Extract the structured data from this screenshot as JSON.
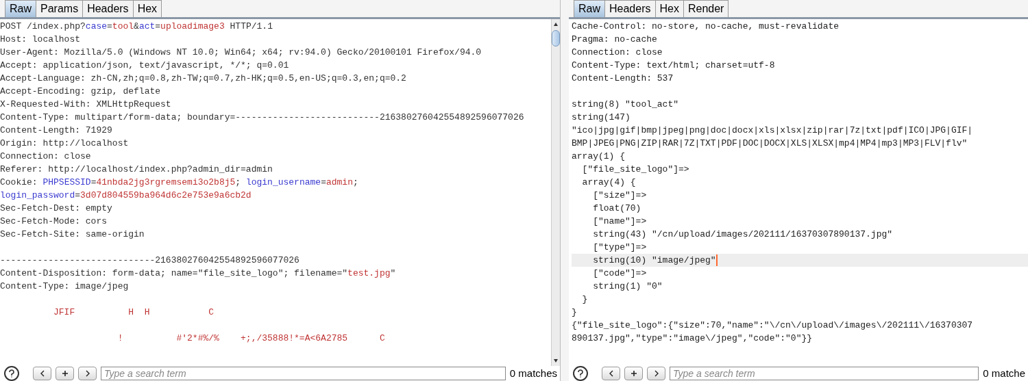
{
  "request": {
    "tabs": [
      {
        "label": "Raw",
        "selected": true
      },
      {
        "label": "Params",
        "selected": false
      },
      {
        "label": "Headers",
        "selected": false
      },
      {
        "label": "Hex",
        "selected": false
      }
    ],
    "lines": [
      {
        "kind": "text",
        "segments": [
          {
            "text": "POST /index.php?",
            "kind": "plain"
          },
          {
            "text": "case",
            "kind": "name"
          },
          {
            "text": "=",
            "kind": "plain"
          },
          {
            "text": "tool",
            "kind": "value"
          },
          {
            "text": "&",
            "kind": "plain"
          },
          {
            "text": "act",
            "kind": "name"
          },
          {
            "text": "=",
            "kind": "plain"
          },
          {
            "text": "uploadimage3",
            "kind": "value"
          },
          {
            "text": " HTTP/1.1",
            "kind": "plain"
          }
        ]
      },
      {
        "kind": "text",
        "segments": [
          {
            "text": "Host: localhost",
            "kind": "plain"
          }
        ]
      },
      {
        "kind": "text",
        "segments": [
          {
            "text": "User-Agent: Mozilla/5.0 (Windows NT 10.0; Win64; x64; rv:94.0) Gecko/20100101 Firefox/94.0",
            "kind": "plain"
          }
        ]
      },
      {
        "kind": "text",
        "segments": [
          {
            "text": "Accept: application/json, text/javascript, */*; q=0.01",
            "kind": "plain"
          }
        ]
      },
      {
        "kind": "text",
        "segments": [
          {
            "text": "Accept-Language: zh-CN,zh;q=0.8,zh-TW;q=0.7,zh-HK;q=0.5,en-US;q=0.3,en;q=0.2",
            "kind": "plain"
          }
        ]
      },
      {
        "kind": "text",
        "segments": [
          {
            "text": "Accept-Encoding: gzip, deflate",
            "kind": "plain"
          }
        ]
      },
      {
        "kind": "text",
        "segments": [
          {
            "text": "X-Requested-With: XMLHttpRequest",
            "kind": "plain"
          }
        ]
      },
      {
        "kind": "text",
        "segments": [
          {
            "text": "Content-Type: multipart/form-data; boundary=---------------------------216380276042554892596077026",
            "kind": "plain"
          }
        ]
      },
      {
        "kind": "text",
        "segments": [
          {
            "text": "Content-Length: 71929",
            "kind": "plain"
          }
        ]
      },
      {
        "kind": "text",
        "segments": [
          {
            "text": "Origin: http://localhost",
            "kind": "plain"
          }
        ]
      },
      {
        "kind": "text",
        "segments": [
          {
            "text": "Connection: close",
            "kind": "plain"
          }
        ]
      },
      {
        "kind": "text",
        "segments": [
          {
            "text": "Referer: http://localhost/index.php?admin_dir=admin",
            "kind": "plain"
          }
        ]
      },
      {
        "kind": "text",
        "segments": [
          {
            "text": "Cookie: ",
            "kind": "plain"
          },
          {
            "text": "PHPSESSID",
            "kind": "name"
          },
          {
            "text": "=",
            "kind": "plain"
          },
          {
            "text": "41nbda2jg3rgremsemi3o2b8j5",
            "kind": "value"
          },
          {
            "text": "; ",
            "kind": "plain"
          },
          {
            "text": "login_username",
            "kind": "name"
          },
          {
            "text": "=",
            "kind": "plain"
          },
          {
            "text": "admin",
            "kind": "value"
          },
          {
            "text": ";",
            "kind": "plain"
          }
        ]
      },
      {
        "kind": "text",
        "segments": [
          {
            "text": "login_password",
            "kind": "name"
          },
          {
            "text": "=",
            "kind": "plain"
          },
          {
            "text": "3d07d804559ba964d6c2e753e9a6cb2d",
            "kind": "value"
          }
        ]
      },
      {
        "kind": "text",
        "segments": [
          {
            "text": "Sec-Fetch-Dest: empty",
            "kind": "plain"
          }
        ]
      },
      {
        "kind": "text",
        "segments": [
          {
            "text": "Sec-Fetch-Mode: cors",
            "kind": "plain"
          }
        ]
      },
      {
        "kind": "text",
        "segments": [
          {
            "text": "Sec-Fetch-Site: same-origin",
            "kind": "plain"
          }
        ]
      },
      {
        "kind": "blank"
      },
      {
        "kind": "text",
        "segments": [
          {
            "text": "-----------------------------216380276042554892596077026",
            "kind": "plain"
          }
        ]
      },
      {
        "kind": "text",
        "segments": [
          {
            "text": "Content-Disposition: form-data; name=\"file_site_logo\"; filename=\"",
            "kind": "plain"
          },
          {
            "text": "test.jpg",
            "kind": "value"
          },
          {
            "text": "\"",
            "kind": "plain"
          }
        ]
      },
      {
        "kind": "text",
        "segments": [
          {
            "text": "Content-Type: image/jpeg",
            "kind": "plain"
          }
        ]
      },
      {
        "kind": "blank"
      },
      {
        "kind": "text",
        "segments": [
          {
            "text": "          JFIF          H  H           C",
            "kind": "value"
          }
        ]
      },
      {
        "kind": "blank"
      },
      {
        "kind": "text",
        "segments": [
          {
            "text": "                      !          #'2*#%/%    +;,/35888!*=A<6A2785      C",
            "kind": "value"
          }
        ]
      }
    ],
    "search": {
      "placeholder": "Type a search term",
      "matches": "0 matches"
    }
  },
  "response": {
    "tabs": [
      {
        "label": "Raw",
        "selected": true
      },
      {
        "label": "Headers",
        "selected": false
      },
      {
        "label": "Hex",
        "selected": false
      },
      {
        "label": "Render",
        "selected": false
      }
    ],
    "lines": [
      {
        "kind": "text",
        "text": "Cache-Control: no-store, no-cache, must-revalidate",
        "selected": false
      },
      {
        "kind": "text",
        "text": "Pragma: no-cache",
        "selected": false
      },
      {
        "kind": "text",
        "text": "Connection: close",
        "selected": false
      },
      {
        "kind": "text",
        "text": "Content-Type: text/html; charset=utf-8",
        "selected": false
      },
      {
        "kind": "text",
        "text": "Content-Length: 537",
        "selected": false
      },
      {
        "kind": "blank",
        "selected": false
      },
      {
        "kind": "text",
        "text": "string(8) \"tool_act\"",
        "selected": false
      },
      {
        "kind": "text",
        "text": "string(147)",
        "selected": false
      },
      {
        "kind": "text",
        "text": "\"ico|jpg|gif|bmp|jpeg|png|doc|docx|xls|xlsx|zip|rar|7z|txt|pdf|ICO|JPG|GIF|",
        "selected": false
      },
      {
        "kind": "text",
        "text": "BMP|JPEG|PNG|ZIP|RAR|7Z|TXT|PDF|DOC|DOCX|XLS|XLSX|mp4|MP4|mp3|MP3|FLV|flv\"",
        "selected": false
      },
      {
        "kind": "text",
        "text": "array(1) {",
        "selected": false
      },
      {
        "kind": "text",
        "text": "  [\"file_site_logo\"]=>",
        "selected": false
      },
      {
        "kind": "text",
        "text": "  array(4) {",
        "selected": false
      },
      {
        "kind": "text",
        "text": "    [\"size\"]=>",
        "selected": false
      },
      {
        "kind": "text",
        "text": "    float(70)",
        "selected": false
      },
      {
        "kind": "text",
        "text": "    [\"name\"]=>",
        "selected": false
      },
      {
        "kind": "text",
        "text": "    string(43) \"/cn/upload/images/202111/16370307890137.jpg\"",
        "selected": false
      },
      {
        "kind": "text",
        "text": "    [\"type\"]=>",
        "selected": false
      },
      {
        "kind": "text",
        "text": "    string(10) \"image/jpeg\"",
        "selected": true
      },
      {
        "kind": "text",
        "text": "    [\"code\"]=>",
        "selected": false
      },
      {
        "kind": "text",
        "text": "    string(1) \"0\"",
        "selected": false
      },
      {
        "kind": "text",
        "text": "  }",
        "selected": false
      },
      {
        "kind": "text",
        "text": "}",
        "selected": false
      },
      {
        "kind": "text",
        "text": "{\"file_site_logo\":{\"size\":70,\"name\":\"\\/cn\\/upload\\/images\\/202111\\/16370307",
        "selected": false
      },
      {
        "kind": "text",
        "text": "890137.jpg\",\"type\":\"image\\/jpeg\",\"code\":\"0\"}}",
        "selected": false
      }
    ],
    "search": {
      "placeholder": "Type a search term",
      "matches": "0 matche"
    }
  }
}
